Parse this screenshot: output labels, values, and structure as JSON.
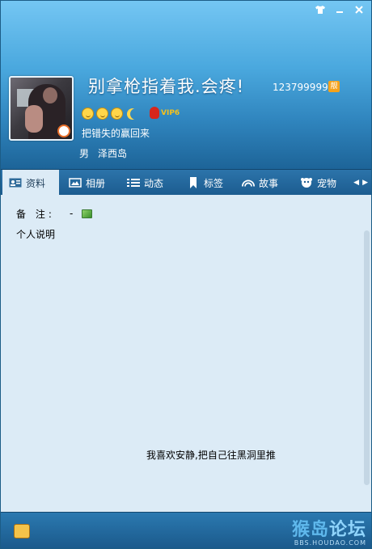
{
  "window": {
    "buttons": [
      "skin",
      "minimize",
      "close"
    ]
  },
  "profile": {
    "nickname": "别拿枪指着我.会疼!",
    "qq_number": "123799999",
    "qq_badge": "靓",
    "vip_level": "VIP6",
    "signature": "把错失的赢回来",
    "gender": "男",
    "location": "泽西岛"
  },
  "tabs": [
    {
      "label": "资料",
      "icon": "profile-card-icon",
      "active": true
    },
    {
      "label": "相册",
      "icon": "photo-album-icon",
      "active": false
    },
    {
      "label": "动态",
      "icon": "feed-list-icon",
      "active": false
    },
    {
      "label": "标签",
      "icon": "bookmark-tag-icon",
      "active": false
    },
    {
      "label": "故事",
      "icon": "rainbow-story-icon",
      "active": false
    },
    {
      "label": "宠物",
      "icon": "pet-penguin-icon",
      "active": false
    }
  ],
  "content": {
    "remark_label": "备 注:",
    "remark_value": "-",
    "section_title": "个人说明",
    "description": "我喜欢安静,把自己往黑洞里推"
  },
  "watermark": {
    "main_part1": "猴岛",
    "main_part2": "论坛",
    "sub": "BBS.HOUDAO.COM"
  },
  "colors": {
    "header_top": "#74c6f3",
    "header_bottom": "#1d6498",
    "content_bg": "#dcebf6",
    "tabbar_bg": "#1c5c90"
  }
}
